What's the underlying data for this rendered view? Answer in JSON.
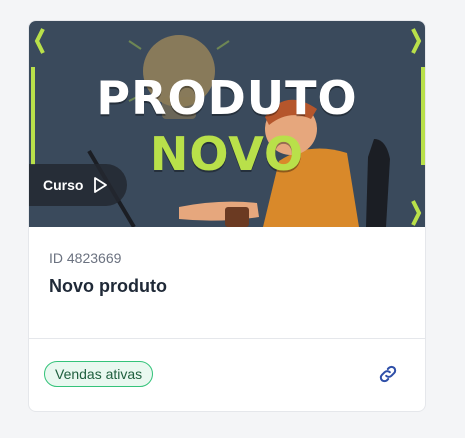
{
  "card": {
    "banner_title_line1": "PRODUTO",
    "banner_title_line2": "NOVO",
    "type_badge": "Curso",
    "product_id": "ID 4823669",
    "product_name": "Novo produto",
    "status": "Vendas ativas"
  },
  "colors": {
    "banner_bg": "#3a4a5c",
    "accent_green": "#b9e04a",
    "status_border": "#34c37a",
    "link_icon": "#2f4fa8"
  },
  "icons": {
    "play": "play-icon",
    "link": "link-icon"
  }
}
